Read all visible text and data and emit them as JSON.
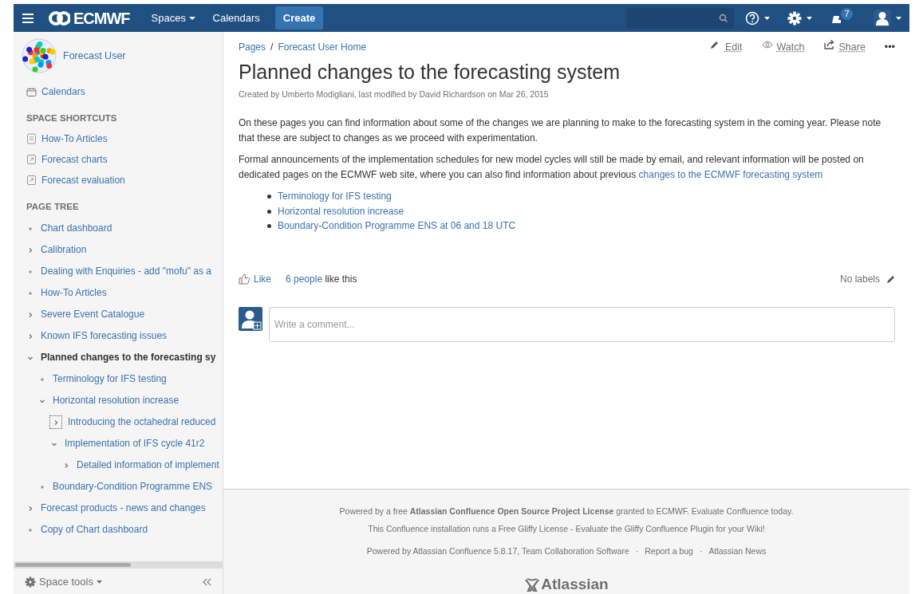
{
  "header": {
    "logo": "ECMWF",
    "nav": [
      {
        "label": "Spaces",
        "dropdown": true
      },
      {
        "label": "Calendars",
        "dropdown": false
      }
    ],
    "create": "Create",
    "notifications": "7"
  },
  "sidebar": {
    "space_name": "Forecast User",
    "calendars": "Calendars",
    "shortcuts_heading": "SPACE SHORTCUTS",
    "shortcuts": [
      {
        "label": "How-To Articles",
        "kind": "page"
      },
      {
        "label": "Forecast charts",
        "kind": "link"
      },
      {
        "label": "Forecast evaluation",
        "kind": "link"
      }
    ],
    "tree_heading": "PAGE TREE",
    "tree": [
      {
        "label": "Chart dashboard",
        "kind": "leaf",
        "current": false,
        "focused": false
      },
      {
        "label": "Calibration",
        "kind": "collapsed",
        "current": false,
        "focused": false
      },
      {
        "label": "Dealing with Enquiries - add \"mofu\" as a",
        "kind": "leaf",
        "current": false,
        "focused": false
      },
      {
        "label": "How-To Articles",
        "kind": "leaf",
        "current": false,
        "focused": false
      },
      {
        "label": "Severe Event Catalogue",
        "kind": "collapsed",
        "current": false,
        "focused": false
      },
      {
        "label": "Known IFS forecasting issues",
        "kind": "collapsed",
        "current": false,
        "focused": false
      },
      {
        "label": "Planned changes to the forecasting sy",
        "kind": "expanded",
        "current": true,
        "focused": false,
        "children": [
          {
            "label": "Terminology for IFS testing",
            "kind": "leaf",
            "current": false,
            "focused": false
          },
          {
            "label": "Horizontal resolution increase",
            "kind": "expanded",
            "current": false,
            "focused": false,
            "children": [
              {
                "label": "Introducing the octahedral reduced",
                "kind": "collapsed",
                "current": false,
                "focused": true
              },
              {
                "label": "Implementation of IFS cycle 41r2",
                "kind": "expanded",
                "current": false,
                "focused": false,
                "children": [
                  {
                    "label": "Detailed information of implement",
                    "kind": "collapsed",
                    "current": false,
                    "focused": false
                  }
                ]
              }
            ]
          },
          {
            "label": "Boundary-Condition Programme ENS",
            "kind": "leaf",
            "current": false,
            "focused": false
          }
        ]
      },
      {
        "label": "Forecast products - news and changes",
        "kind": "collapsed",
        "current": false,
        "focused": false
      },
      {
        "label": "Copy of Chart dashboard",
        "kind": "leaf",
        "current": false,
        "focused": false
      }
    ],
    "space_tools": "Space tools"
  },
  "page": {
    "breadcrumbs": [
      "Pages",
      "Forecast User Home"
    ],
    "breadcrumb_separator": "/",
    "actions": [
      {
        "label": "Edit",
        "kind": "edit"
      },
      {
        "label": "Watch",
        "kind": "watch"
      },
      {
        "label": "Share",
        "kind": "share"
      },
      {
        "label": "•••",
        "kind": "more"
      }
    ],
    "title": "Planned changes to the forecasting system",
    "byline": "Created by Umberto Modigliani, last modified by David Richardson on Mar 26, 2015",
    "paragraph_1": "On these pages you can find information about some of the changes we are planning to make to the forecasting system in the coming year. Please note that these are subject to changes as we proceed with experimentation.",
    "paragraph_2": "Formal announcements of the implementation schedules for new model cycles will still be made by email, and relevant information will be posted on dedicated pages on the ECMWF web site, where you can also find information about previous",
    "paragraph_2_link": "changes to the ECMWF forecasting system",
    "links": [
      "Terminology for IFS testing",
      "Horizontal resolution increase",
      "Boundary-Condition Programme ENS at 06 and 18 UTC"
    ],
    "like": "Like",
    "likers": "6 people",
    "likers_suffix": "like this",
    "labels": "No labels",
    "comment": {
      "placeholder": "Write a comment..."
    }
  },
  "footer": {
    "line_1": "Powered by a free **Atlassian Confluence Open Source Project License** granted to ECMWF. Evaluate Confluence today.",
    "line_2": "This Confluence installation runs a Free Gliffy License - Evaluate the Gliffy Confluence Plugin for your Wiki!",
    "links": [
      "Powered by Atlassian Confluence 5.8.17, Team Collaboration Software",
      "Report a bug",
      "Atlassian News"
    ],
    "separator": "·",
    "logo": "Atlassian"
  }
}
